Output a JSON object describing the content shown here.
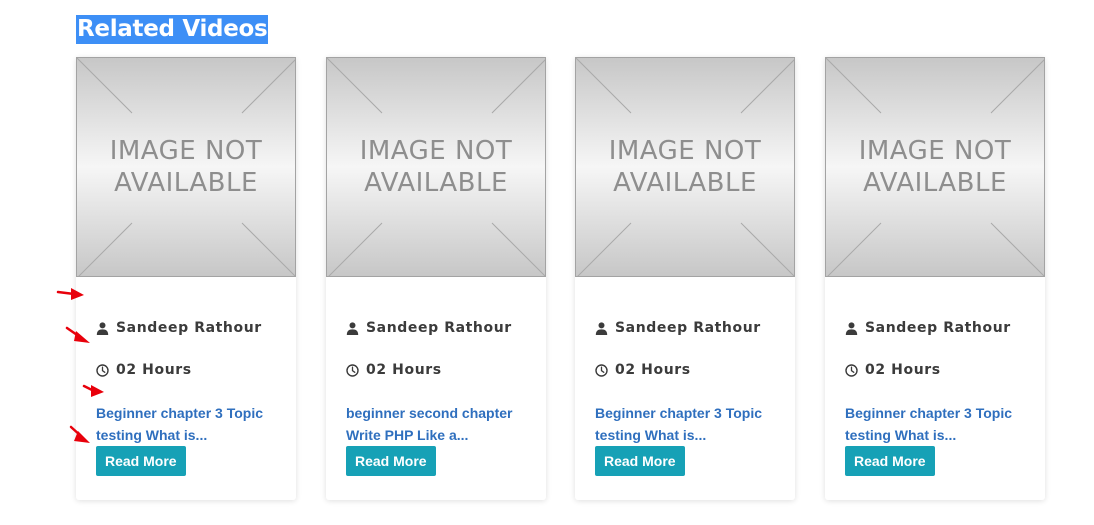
{
  "section": {
    "title": "Related Videos"
  },
  "placeholder_image": {
    "line1": "IMAGE NOT",
    "line2": "AVAILABLE"
  },
  "videos": [
    {
      "author": "Sandeep Rathour",
      "duration": "02 Hours",
      "title_line1": "Beginner chapter 3 Topic",
      "title_line2": "testing What is...",
      "button": "Read More"
    },
    {
      "author": "Sandeep Rathour",
      "duration": "02 Hours",
      "title_line1": "beginner second chapter",
      "title_line2": "Write PHP Like a...",
      "button": "Read More"
    },
    {
      "author": "Sandeep Rathour",
      "duration": "02 Hours",
      "title_line1": "Beginner chapter 3 Topic",
      "title_line2": "testing What is...",
      "button": "Read More"
    },
    {
      "author": "Sandeep Rathour",
      "duration": "02 Hours",
      "title_line1": "Beginner chapter 3 Topic",
      "title_line2": "testing What is...",
      "button": "Read More"
    }
  ],
  "icons": {
    "author": "user-icon",
    "duration": "clock-icon",
    "annotation": "red-arrow-icon"
  },
  "colors": {
    "title_highlight": "#3d8ff6",
    "link": "#2f6fbe",
    "button": "#16a1b6",
    "annotation_arrow": "#e8000b"
  }
}
